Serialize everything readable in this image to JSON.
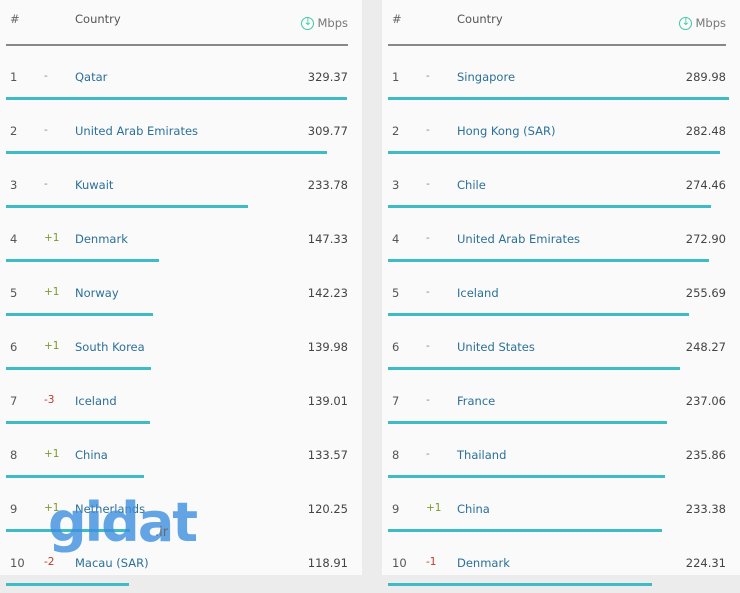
{
  "header": {
    "rank": "#",
    "country": "Country",
    "unit": "Mbps",
    "unit_icon": "download-arrow-icon"
  },
  "colors": {
    "bar": "#3dbcc6",
    "country_link": "#2b7099",
    "up": "#7a9a2e",
    "down": "#c0392b",
    "icon": "#3ec9a7"
  },
  "tables": [
    {
      "max": 329.37,
      "rows": [
        {
          "rank": "1",
          "change": "-",
          "country": "Qatar",
          "value": "329.37"
        },
        {
          "rank": "2",
          "change": "-",
          "country": "United Arab Emirates",
          "value": "309.77"
        },
        {
          "rank": "3",
          "change": "-",
          "country": "Kuwait",
          "value": "233.78"
        },
        {
          "rank": "4",
          "change": "+1",
          "country": "Denmark",
          "value": "147.33"
        },
        {
          "rank": "5",
          "change": "+1",
          "country": "Norway",
          "value": "142.23"
        },
        {
          "rank": "6",
          "change": "+1",
          "country": "South Korea",
          "value": "139.98"
        },
        {
          "rank": "7",
          "change": "-3",
          "country": "Iceland",
          "value": "139.01"
        },
        {
          "rank": "8",
          "change": "+1",
          "country": "China",
          "value": "133.57"
        },
        {
          "rank": "9",
          "change": "+1",
          "country": "Netherlands",
          "value": "120.25"
        },
        {
          "rank": "10",
          "change": "-2",
          "country": "Macau (SAR)",
          "value": "118.91"
        }
      ]
    },
    {
      "max": 289.98,
      "rows": [
        {
          "rank": "1",
          "change": "-",
          "country": "Singapore",
          "value": "289.98"
        },
        {
          "rank": "2",
          "change": "-",
          "country": "Hong Kong (SAR)",
          "value": "282.48"
        },
        {
          "rank": "3",
          "change": "-",
          "country": "Chile",
          "value": "274.46"
        },
        {
          "rank": "4",
          "change": "-",
          "country": "United Arab Emirates",
          "value": "272.90"
        },
        {
          "rank": "5",
          "change": "-",
          "country": "Iceland",
          "value": "255.69"
        },
        {
          "rank": "6",
          "change": "-",
          "country": "United States",
          "value": "248.27"
        },
        {
          "rank": "7",
          "change": "-",
          "country": "France",
          "value": "237.06"
        },
        {
          "rank": "8",
          "change": "-",
          "country": "Thailand",
          "value": "235.86"
        },
        {
          "rank": "9",
          "change": "+1",
          "country": "China",
          "value": "233.38"
        },
        {
          "rank": "10",
          "change": "-1",
          "country": "Denmark",
          "value": "224.31"
        }
      ]
    }
  ],
  "watermark": {
    "logo": "gidat",
    "suffix": ".ir"
  }
}
